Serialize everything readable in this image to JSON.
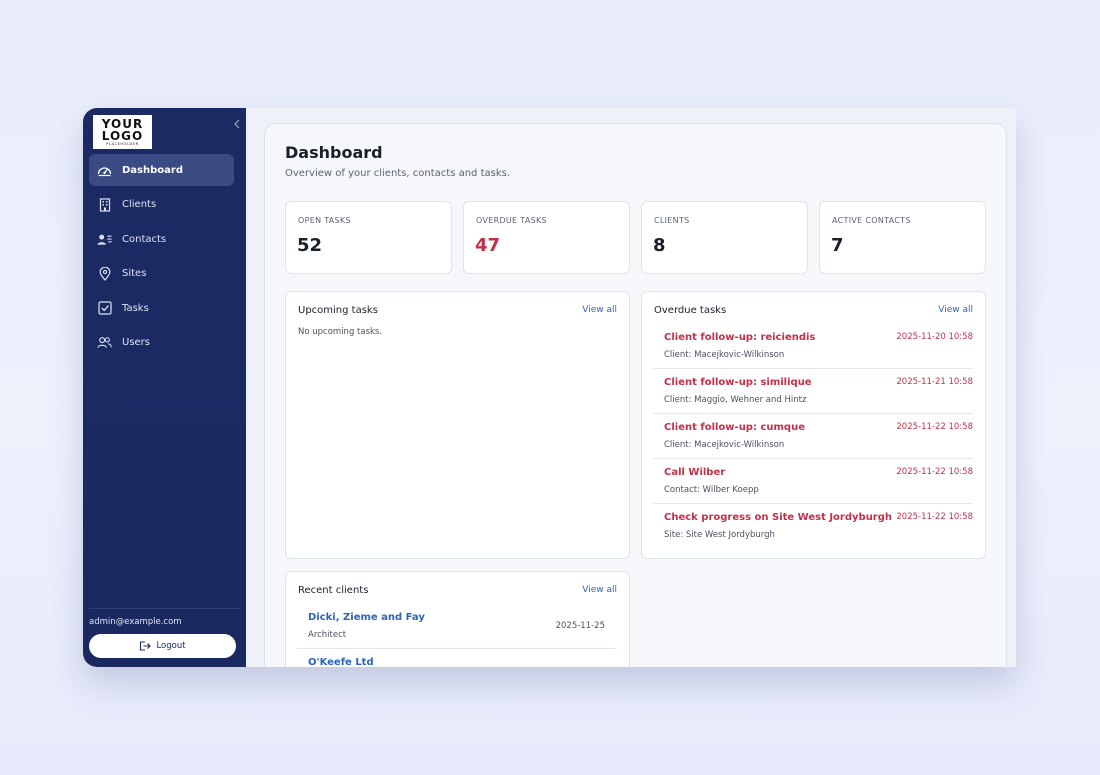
{
  "sidebar": {
    "logo": {
      "line1": "YOUR",
      "line2": "LOGO",
      "line3": "PLACEHOLDER"
    },
    "items": [
      {
        "label": "Dashboard",
        "icon": "dashboard-gauge-icon",
        "active": true
      },
      {
        "label": "Clients",
        "icon": "building-icon"
      },
      {
        "label": "Contacts",
        "icon": "contacts-icon"
      },
      {
        "label": "Sites",
        "icon": "map-pin-icon"
      },
      {
        "label": "Tasks",
        "icon": "checkbox-icon"
      },
      {
        "label": "Users",
        "icon": "users-icon"
      }
    ],
    "user_email": "admin@example.com",
    "logout_label": "Logout"
  },
  "header": {
    "title": "Dashboard",
    "subtitle": "Overview of your clients, contacts and tasks."
  },
  "stats": [
    {
      "label": "OPEN TASKS",
      "value": "52"
    },
    {
      "label": "OVERDUE TASKS",
      "value": "47",
      "color": "#c0324a"
    },
    {
      "label": "CLIENTS",
      "value": "8"
    },
    {
      "label": "ACTIVE CONTACTS",
      "value": "7"
    }
  ],
  "upcoming": {
    "title": "Upcoming tasks",
    "view_all": "View all",
    "empty": "No upcoming tasks."
  },
  "overdue": {
    "title": "Overdue tasks",
    "view_all": "View all",
    "items": [
      {
        "title": "Client follow-up: reiciendis",
        "date": "2025-11-20 10:58",
        "sub": "Client: Macejkovic-Wilkinson"
      },
      {
        "title": "Client follow-up: similique",
        "date": "2025-11-21 10:58",
        "sub": "Client: Maggio, Wehner and Hintz"
      },
      {
        "title": "Client follow-up: cumque",
        "date": "2025-11-22 10:58",
        "sub": "Client: Macejkovic-Wilkinson"
      },
      {
        "title": "Call Wilber",
        "date": "2025-11-22 10:58",
        "sub": "Contact: Wilber Koepp"
      },
      {
        "title": "Check progress on Site West Jordyburgh",
        "date": "2025-11-22 10:58",
        "sub": "Site: Site West Jordyburgh"
      }
    ]
  },
  "recent_clients": {
    "title": "Recent clients",
    "view_all": "View all",
    "items": [
      {
        "name": "Dicki, Zieme and Fay",
        "industry": "Architect",
        "date": "2025-11-25"
      },
      {
        "name": "O'Keefe Ltd",
        "industry": "",
        "date": ""
      }
    ]
  },
  "colors": {
    "sidebar": "#1b2a63",
    "accent": "#2f63b7",
    "danger": "#c0324a"
  }
}
